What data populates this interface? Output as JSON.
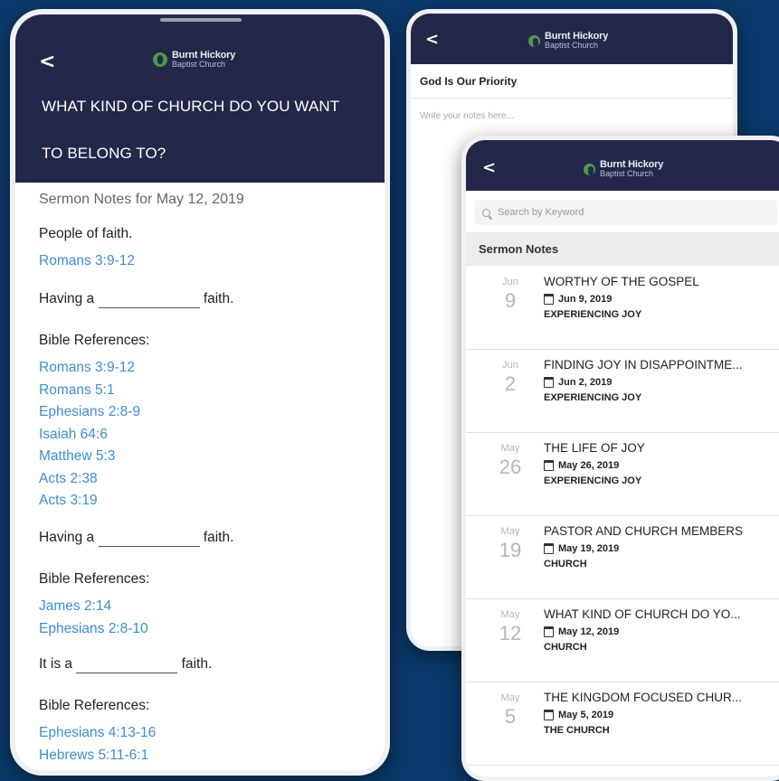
{
  "colors": {
    "background": "#0a3a6b",
    "header": "#23284a",
    "link": "#3b8fd6"
  },
  "logo": {
    "line1": "Burnt Hickory",
    "line2": "Baptist Church"
  },
  "phone1": {
    "back_icon": "chevron-left-icon",
    "question_line1": "WHAT KIND OF CHURCH DO YOU WANT",
    "question_line2": "TO BELONG TO?",
    "subtitle": "Sermon Notes for May 12, 2019",
    "people_of_faith": "People of faith.",
    "ref1": "Romans 3:9-12",
    "having_a": "Having a",
    "faith": "faith.",
    "bible_refs_label": "Bible References:",
    "refs_a": [
      "Romans 3:9-12",
      "Romans 5:1",
      "Ephesians 2:8-9",
      "Isaiah 64:6",
      "Matthew 5:3",
      "Acts 2:38",
      "Acts 3:19"
    ],
    "refs_b": [
      "James  2:14",
      "Ephesians 2:8-10"
    ],
    "it_is_a": "It is a",
    "refs_c": [
      "Ephesians 4:13-16",
      "Hebrews 5:11-6:1"
    ]
  },
  "phone2": {
    "back_icon": "chevron-left-icon",
    "title": "God Is Our Priority",
    "notes_placeholder": "Write your notes here..."
  },
  "phone3": {
    "back_icon": "chevron-left-icon",
    "search_placeholder": "Search by Keyword",
    "section_title": "Sermon Notes",
    "sermons": [
      {
        "mon": "Jun",
        "day": "9",
        "title": "WORTHY OF THE GOSPEL",
        "date": "Jun 9, 2019",
        "series": "EXPERIENCING JOY"
      },
      {
        "mon": "Jun",
        "day": "2",
        "title": "FINDING JOY IN DISAPPOINTME...",
        "date": "Jun 2, 2019",
        "series": "EXPERIENCING JOY"
      },
      {
        "mon": "May",
        "day": "26",
        "title": "THE LIFE OF JOY",
        "date": "May 26, 2019",
        "series": "EXPERIENCING JOY"
      },
      {
        "mon": "May",
        "day": "19",
        "title": "PASTOR AND CHURCH MEMBERS",
        "date": "May 19, 2019",
        "series": "CHURCH"
      },
      {
        "mon": "May",
        "day": "12",
        "title": "WHAT KIND OF CHURCH DO YO...",
        "date": "May 12, 2019",
        "series": "CHURCH"
      },
      {
        "mon": "May",
        "day": "5",
        "title": "THE KINGDOM FOCUSED CHUR...",
        "date": "May 5, 2019",
        "series": "THE CHURCH"
      }
    ]
  }
}
